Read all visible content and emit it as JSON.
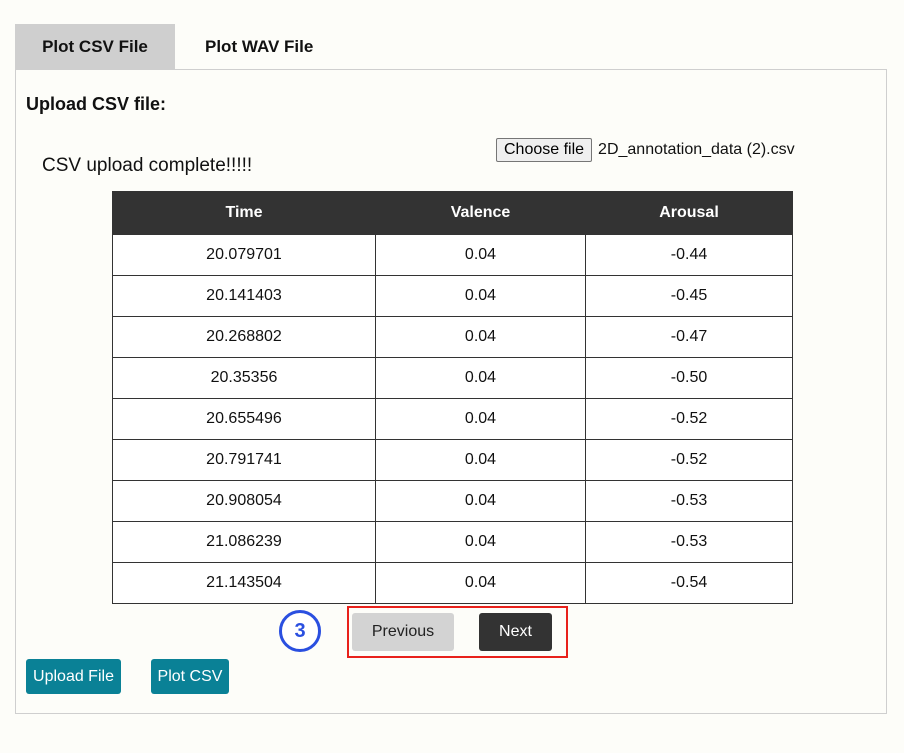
{
  "tabs": [
    {
      "label": "Plot CSV File",
      "active": true
    },
    {
      "label": "Plot WAV File",
      "active": false
    }
  ],
  "panel": {
    "section_title": "Upload CSV file:",
    "file_input": {
      "button_label": "Choose file",
      "file_name": "2D_annotation_data (2).csv"
    },
    "status_message": "CSV upload complete!!!!!"
  },
  "table": {
    "headers": [
      "Time",
      "Valence",
      "Arousal"
    ],
    "rows": [
      [
        "20.079701",
        "0.04",
        "-0.44"
      ],
      [
        "20.141403",
        "0.04",
        "-0.45"
      ],
      [
        "20.268802",
        "0.04",
        "-0.47"
      ],
      [
        "20.35356",
        "0.04",
        "-0.50"
      ],
      [
        "20.655496",
        "0.04",
        "-0.52"
      ],
      [
        "20.791741",
        "0.04",
        "-0.52"
      ],
      [
        "20.908054",
        "0.04",
        "-0.53"
      ],
      [
        "21.086239",
        "0.04",
        "-0.53"
      ],
      [
        "21.143504",
        "0.04",
        "-0.54"
      ]
    ]
  },
  "pagination": {
    "step_badge": "3",
    "previous_label": "Previous",
    "next_label": "Next",
    "highlight_color": "#e8211b"
  },
  "actions": {
    "upload_label": "Upload File",
    "plot_label": "Plot CSV"
  },
  "colors": {
    "accent": "#0a8196",
    "header_dark": "#333333",
    "badge_blue": "#2a4fe0"
  }
}
